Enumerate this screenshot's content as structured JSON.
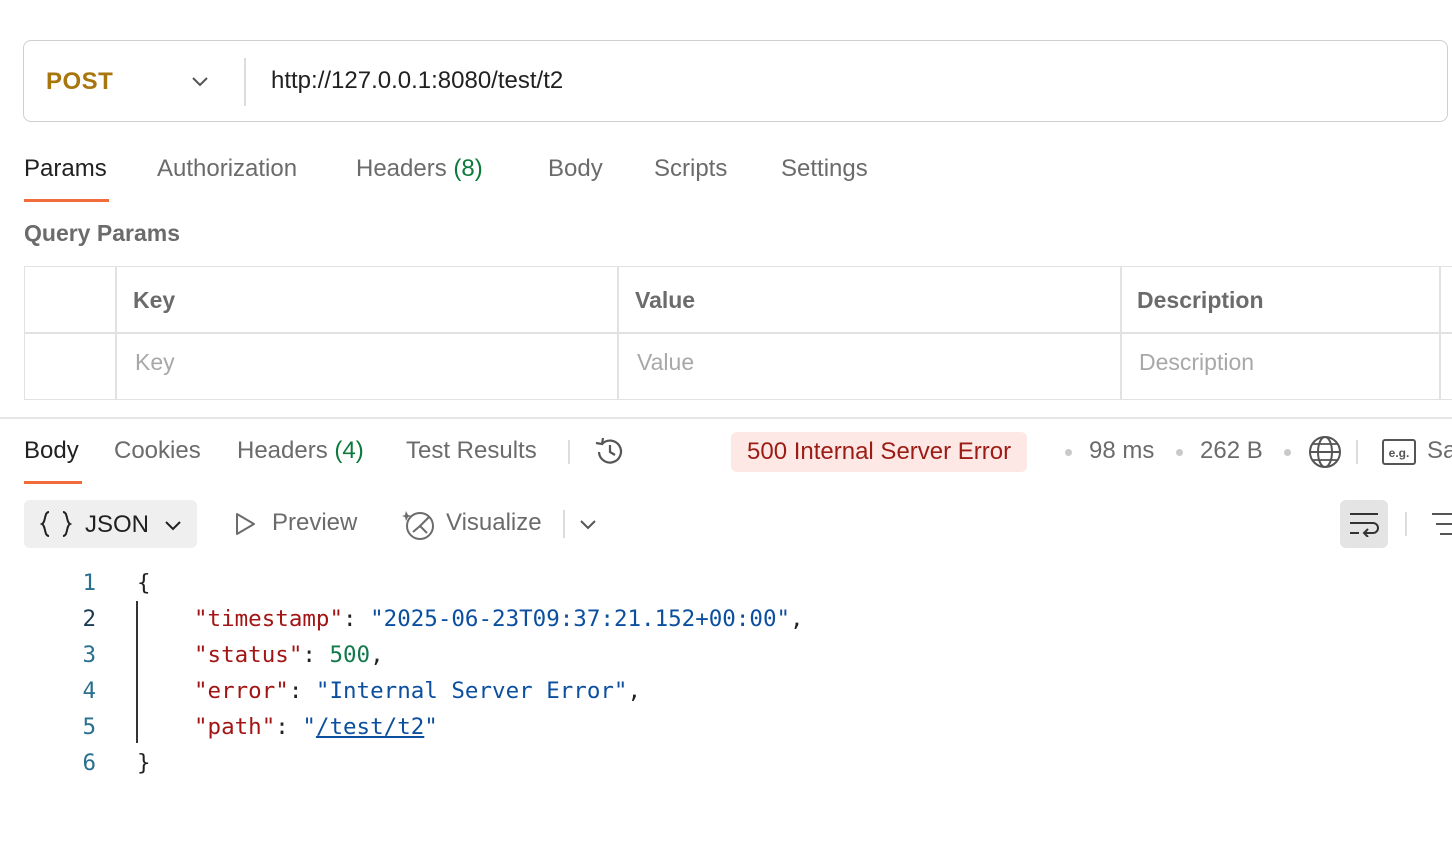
{
  "request": {
    "method": "POST",
    "url": "http://127.0.0.1:8080/test/t2"
  },
  "request_tabs": {
    "params": "Params",
    "authorization": "Authorization",
    "headers": "Headers",
    "headers_count": "(8)",
    "body": "Body",
    "scripts": "Scripts",
    "settings": "Settings"
  },
  "query_params": {
    "title": "Query Params",
    "columns": {
      "key": "Key",
      "value": "Value",
      "description": "Description"
    },
    "placeholders": {
      "key": "Key",
      "value": "Value",
      "description": "Description"
    }
  },
  "response_tabs": {
    "body": "Body",
    "cookies": "Cookies",
    "headers": "Headers",
    "headers_count": "(4)",
    "test_results": "Test Results"
  },
  "response_meta": {
    "status": "500 Internal Server Error",
    "time": "98 ms",
    "size": "262 B",
    "save_partial": "Sa"
  },
  "toolbar": {
    "format": "JSON",
    "preview": "Preview",
    "visualize": "Visualize"
  },
  "code": {
    "line_numbers": [
      "1",
      "2",
      "3",
      "4",
      "5",
      "6"
    ],
    "open_brace": "{",
    "close_brace": "}",
    "entries": [
      {
        "key": "\"timestamp\"",
        "value": "\"2025-06-23T09:37:21.152+00:00\""
      },
      {
        "key": "\"status\"",
        "value": "500"
      },
      {
        "key": "\"error\"",
        "value": "\"Internal Server Error\""
      },
      {
        "key": "\"path\"",
        "value": "/test/t2"
      }
    ]
  },
  "colors": {
    "method": "#a8760c",
    "active_tab_underline": "#f26b3a",
    "count": "#0c7a3a",
    "error_badge_bg": "#fde8e6",
    "error_badge_text": "#9b1c14"
  }
}
